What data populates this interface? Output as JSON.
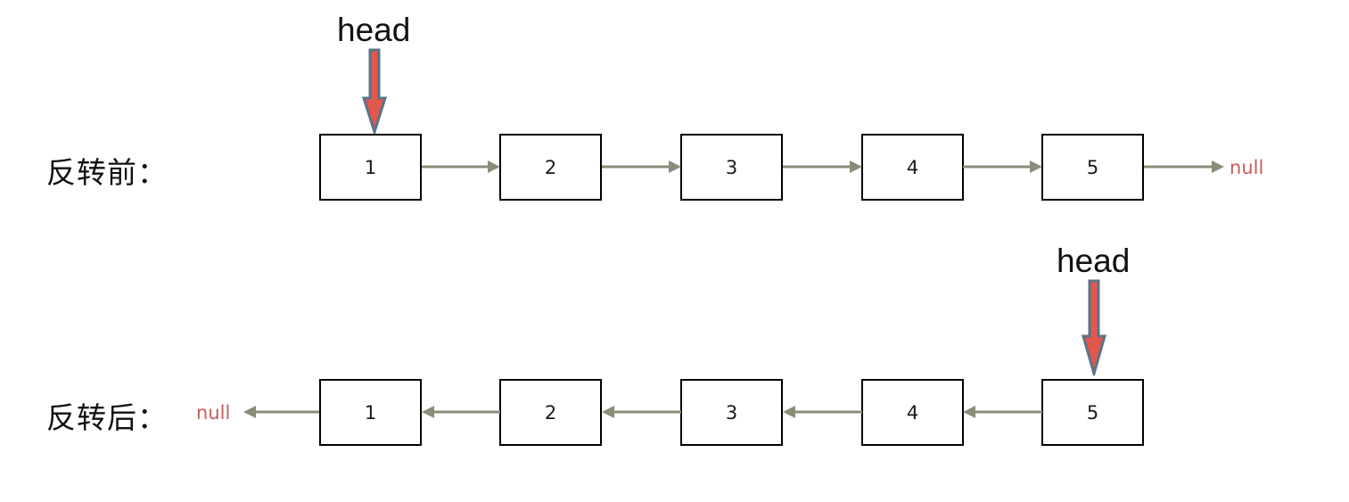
{
  "colors": {
    "node_border": "#000000",
    "node_fill": "#ffffff",
    "link": "#8c8c79",
    "null_text": "#c85c5c",
    "head_fill": "#e2574c",
    "head_stroke": "#5a7389",
    "text": "#111111",
    "background": "#ffffff"
  },
  "diagram": {
    "title": "linked-list-reversal",
    "rows": [
      {
        "id": "before",
        "label": "反转前：",
        "head_label": "head",
        "head_target_node": "1",
        "direction": "right",
        "nodes": [
          {
            "value": "1"
          },
          {
            "value": "2"
          },
          {
            "value": "3"
          },
          {
            "value": "4"
          },
          {
            "value": "5"
          }
        ],
        "terminator": "null",
        "terminator_side": "right"
      },
      {
        "id": "after",
        "label": "反转后：",
        "head_label": "head",
        "head_target_node": "5",
        "direction": "left",
        "nodes": [
          {
            "value": "1"
          },
          {
            "value": "2"
          },
          {
            "value": "3"
          },
          {
            "value": "4"
          },
          {
            "value": "5"
          }
        ],
        "terminator": "null",
        "terminator_side": "left"
      }
    ]
  }
}
